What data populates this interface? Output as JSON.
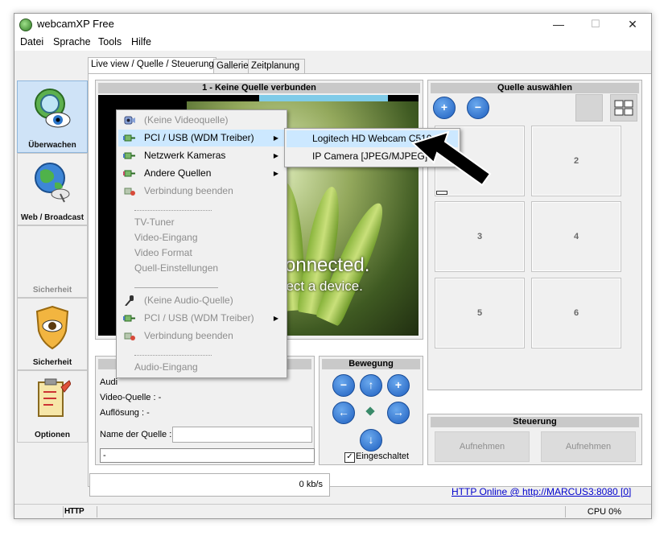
{
  "window": {
    "title": "webcamXP Free",
    "minimize": "—",
    "maximize": "☐",
    "close": "✕"
  },
  "menu": [
    "Datei",
    "Sprache",
    "Tools",
    "Hilfe"
  ],
  "toolbar": [
    {
      "label": "Überwachen",
      "icon": "monitor-eye-icon"
    },
    {
      "label": "Web / Broadcast",
      "icon": "globe-satellite-icon"
    },
    {
      "label": "Sicherheit",
      "icon": ""
    },
    {
      "label": "Sicherheit",
      "icon": "shield-eye-icon"
    },
    {
      "label": "Optionen",
      "icon": "options-clipboard-icon"
    }
  ],
  "tabs": [
    "Live view / Quelle / Steuerung",
    "Gallerie",
    "Zeitplanung"
  ],
  "video_panel": {
    "title": "1 - Keine Quelle verbunden",
    "overlay_line1": "connected.",
    "overlay_line2": "nect a device."
  },
  "info_panel": {
    "audio_label": "Audi",
    "video_source": "Video-Quelle : -",
    "resolution": "Auflösung : -",
    "source_name_label": "Name der Quelle :",
    "source_name_value": "",
    "source_path": "-"
  },
  "movement_panel": {
    "title": "Bewegung",
    "enabled_label": "Eingeschaltet",
    "enabled": true
  },
  "source_panel": {
    "title": "Quelle auswählen",
    "cells": [
      "",
      "2",
      "3",
      "4",
      "5",
      "6"
    ]
  },
  "control_panel": {
    "title": "Steuerung",
    "record1": "Aufnehmen",
    "record2": "Aufnehmen"
  },
  "context_menu": {
    "items": [
      {
        "label": "(Keine Videoquelle)",
        "enabled": false,
        "icon": "webcam-icon"
      },
      {
        "label": "PCI / USB (WDM Treiber)",
        "enabled": true,
        "selected": true,
        "submenu": true,
        "icon": "usb-plug-icon"
      },
      {
        "label": "Netzwerk Kameras",
        "enabled": true,
        "submenu": true,
        "icon": "network-plug-icon"
      },
      {
        "label": "Andere Quellen",
        "enabled": true,
        "submenu": true,
        "icon": "plug-icon"
      },
      {
        "label": "Verbindung beenden",
        "enabled": false,
        "icon": "disconnect-icon"
      },
      {
        "label": "TV-Tuner",
        "enabled": false
      },
      {
        "label": "Video-Eingang",
        "enabled": false
      },
      {
        "label": "Video Format",
        "enabled": false
      },
      {
        "label": "Quell-Einstellungen",
        "enabled": false
      },
      {
        "label": "(Keine Audio-Quelle)",
        "enabled": false,
        "icon": "microphone-icon"
      },
      {
        "label": "PCI / USB (WDM Treiber)",
        "enabled": false,
        "submenu": true,
        "icon": "usb-plug-icon"
      },
      {
        "label": "Verbindung beenden",
        "enabled": false,
        "icon": "disconnect-icon"
      },
      {
        "label": "Audio-Eingang",
        "enabled": false
      }
    ]
  },
  "submenu": {
    "items": [
      "Logitech HD Webcam C510",
      "IP Camera [JPEG/MJPEG]"
    ]
  },
  "bandwidth": "0 kb/s",
  "http_link": "HTTP Online @ http://MARCUS3:8080 [0]",
  "status": {
    "http": "HTTP",
    "cpu": "CPU 0%"
  },
  "colors": {
    "accent": "#cce8ff",
    "link": "#0000cc",
    "toolbar_active": "#cfe3f7"
  }
}
